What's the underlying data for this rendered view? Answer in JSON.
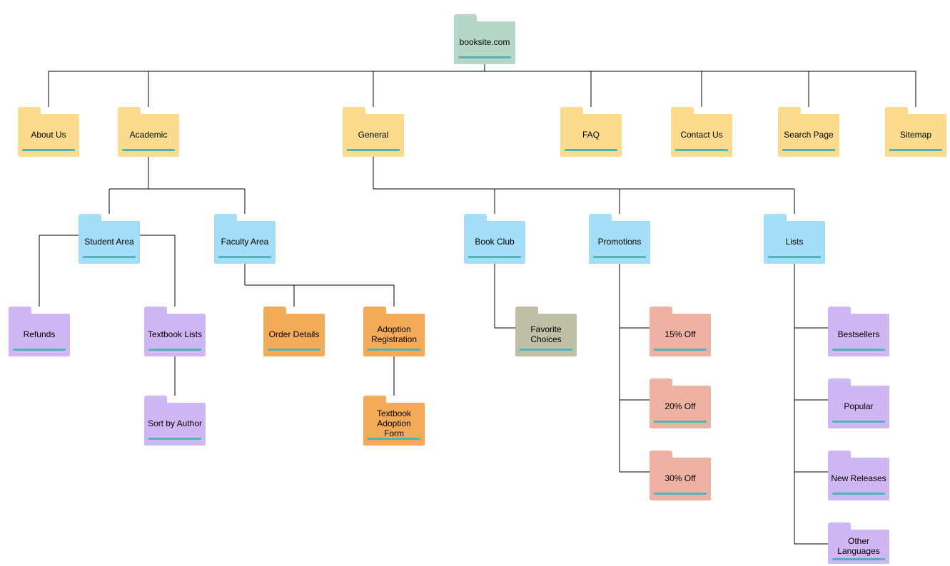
{
  "nodes": {
    "root": {
      "label": "booksite.com"
    },
    "about": {
      "label": "About Us"
    },
    "academic": {
      "label": "Academic"
    },
    "general": {
      "label": "General"
    },
    "faq": {
      "label": "FAQ"
    },
    "contact": {
      "label": "Contact Us"
    },
    "search": {
      "label": "Search Page"
    },
    "sitemap": {
      "label": "Sitemap"
    },
    "student": {
      "label": "Student Area"
    },
    "faculty": {
      "label": "Faculty Area"
    },
    "bookclub": {
      "label": "Book Club"
    },
    "promotions": {
      "label": "Promotions"
    },
    "lists": {
      "label": "Lists"
    },
    "refunds": {
      "label": "Refunds"
    },
    "textlists": {
      "label": "Textbook Lists"
    },
    "sortauthor": {
      "label": "Sort by Author"
    },
    "orderdet": {
      "label": "Order Details"
    },
    "adoptreg": {
      "label": "Adoption Registration"
    },
    "adoptform": {
      "label": "Textbook Adoption Form"
    },
    "favchoices": {
      "label": "Favorite Choices"
    },
    "off15": {
      "label": "15% Off"
    },
    "off20": {
      "label": "20% Off"
    },
    "off30": {
      "label": "30% Off"
    },
    "bestsellers": {
      "label": "Bestsellers"
    },
    "popular": {
      "label": "Popular"
    },
    "newrel": {
      "label": "New Releases"
    },
    "otherlang": {
      "label": "Other Languages"
    }
  }
}
